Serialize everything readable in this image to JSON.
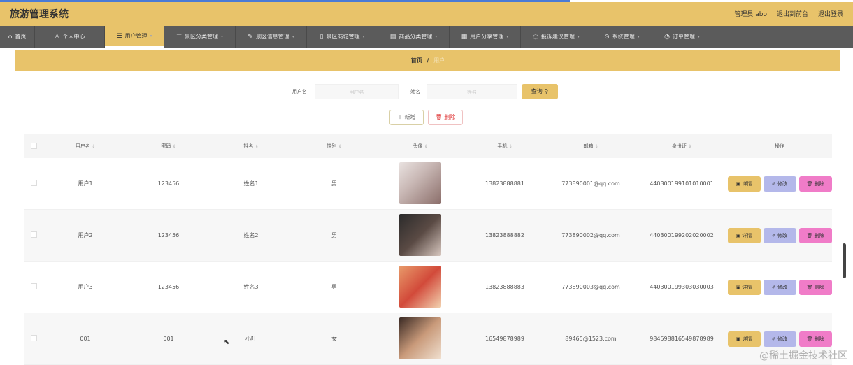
{
  "app": {
    "title": "旅游管理系统"
  },
  "header": {
    "user": "管理员 abo",
    "back_home": "退出到前台",
    "logout": "退出登录"
  },
  "nav": [
    {
      "label": "首页",
      "icon": "home-icon",
      "glyph": "⌂"
    },
    {
      "label": "个人中心",
      "icon": "user-icon",
      "glyph": "♙"
    },
    {
      "label": "用户管理",
      "icon": "list-icon",
      "glyph": "☰"
    },
    {
      "label": "景区分类管理",
      "icon": "list-icon",
      "glyph": "☰"
    },
    {
      "label": "景区信息管理",
      "icon": "edit-icon",
      "glyph": "✎"
    },
    {
      "label": "景区商城管理",
      "icon": "doc-icon",
      "glyph": "▯"
    },
    {
      "label": "商品分类管理",
      "icon": "doc-icon",
      "glyph": "▤"
    },
    {
      "label": "用户分享管理",
      "icon": "grid-icon",
      "glyph": "▦"
    },
    {
      "label": "投诉建议管理",
      "icon": "circle-icon",
      "glyph": "◌"
    },
    {
      "label": "系统管理",
      "icon": "gear-icon",
      "glyph": "⊙"
    },
    {
      "label": "订单管理",
      "icon": "clock-icon",
      "glyph": "◔"
    }
  ],
  "breadcrumb": {
    "home": "首页",
    "sep": "/",
    "current": "用户"
  },
  "search": {
    "username_label": "用户名",
    "username_placeholder": "用户名",
    "name_label": "姓名",
    "name_placeholder": "姓名",
    "button": "查询 ⚲"
  },
  "actions": {
    "add": "＋ 新增",
    "delete": "🗑 删除"
  },
  "table": {
    "headers": [
      "用户名",
      "密码",
      "姓名",
      "性别",
      "头像",
      "手机",
      "邮箱",
      "身份证",
      "操作"
    ],
    "sort_mark": "⇕",
    "op_detail": "▣ 详情",
    "op_edit": "✐ 修改",
    "op_delete": "🗑 删除",
    "rows": [
      {
        "username": "用户1",
        "password": "123456",
        "name": "姓名1",
        "gender": "男",
        "phone": "13823888881",
        "email": "773890001@qq.com",
        "idcard": "440300199101010001",
        "avatar_bg": "linear-gradient(135deg,#e9e2e0,#c9b8b5 40%,#8b6e6a)"
      },
      {
        "username": "用户2",
        "password": "123456",
        "name": "姓名2",
        "gender": "男",
        "phone": "13823888882",
        "email": "773890002@qq.com",
        "idcard": "440300199202020002",
        "avatar_bg": "linear-gradient(135deg,#2b2b2b,#5a4a44 50%,#d8c8c0)"
      },
      {
        "username": "用户3",
        "password": "123456",
        "name": "姓名3",
        "gender": "男",
        "phone": "13823888883",
        "email": "773890003@qq.com",
        "idcard": "440300199303030003",
        "avatar_bg": "linear-gradient(135deg,#e89a6a,#d24a3a 50%,#f2d2b0)"
      },
      {
        "username": "001",
        "password": "001",
        "name": "小叶",
        "gender": "女",
        "phone": "16549878989",
        "email": "89465@1523.com",
        "idcard": "984598816549878989",
        "avatar_bg": "linear-gradient(135deg,#3a2a24,#c99a7a 50%,#f0e0d0)"
      }
    ]
  },
  "watermark": "@稀土掘金技术社区",
  "colors": {
    "accent": "#e8c36a",
    "nav": "#5b5b5b",
    "edit": "#b4b8ea",
    "delete": "#f07cc8"
  }
}
